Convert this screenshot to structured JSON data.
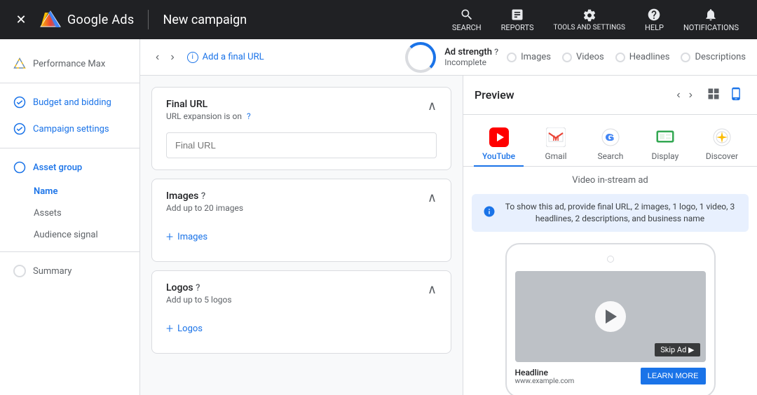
{
  "topNav": {
    "close_label": "×",
    "logo_text": "Google Ads",
    "campaign_title": "New campaign",
    "actions": [
      {
        "id": "search",
        "label": "SEARCH",
        "icon": "search"
      },
      {
        "id": "reports",
        "label": "REPORTS",
        "icon": "bar-chart"
      },
      {
        "id": "tools",
        "label": "TOOLS AND\nSETTINGS",
        "icon": "wrench"
      },
      {
        "id": "help",
        "label": "HELP",
        "icon": "question"
      },
      {
        "id": "notifications",
        "label": "NOTIFICATIONS",
        "icon": "bell"
      }
    ]
  },
  "sidebar": {
    "items": [
      {
        "id": "performance-max",
        "label": "Performance Max",
        "status": "active",
        "icon": "triangle"
      },
      {
        "id": "budget-bidding",
        "label": "Budget and bidding",
        "status": "complete"
      },
      {
        "id": "campaign-settings",
        "label": "Campaign settings",
        "status": "complete"
      },
      {
        "id": "asset-group",
        "label": "Asset group",
        "status": "current",
        "subitems": [
          {
            "id": "name",
            "label": "Name",
            "active": true
          },
          {
            "id": "assets",
            "label": "Assets",
            "active": false
          },
          {
            "id": "audience-signal",
            "label": "Audience signal",
            "active": false
          }
        ]
      },
      {
        "id": "summary",
        "label": "Summary",
        "status": "none"
      }
    ]
  },
  "subHeader": {
    "add_url_label": "Add a final URL",
    "ad_strength_label": "Ad strength",
    "ad_strength_value": "Incomplete",
    "asset_buttons": [
      {
        "id": "images",
        "label": "Images"
      },
      {
        "id": "videos",
        "label": "Videos"
      },
      {
        "id": "headlines",
        "label": "Headlines"
      },
      {
        "id": "descriptions",
        "label": "Descriptions"
      }
    ]
  },
  "editor": {
    "sections": [
      {
        "id": "final-url",
        "title": "Final URL",
        "subtitle": "URL expansion is on",
        "input_placeholder": "Final URL",
        "collapsed": false
      },
      {
        "id": "images",
        "title": "Images",
        "subtitle": "Add up to 20 images",
        "add_label": "Images",
        "collapsed": false
      },
      {
        "id": "logos",
        "title": "Logos",
        "subtitle": "Add up to 5 logos",
        "add_label": "Logos",
        "collapsed": false
      }
    ]
  },
  "preview": {
    "title": "Preview",
    "platforms": [
      {
        "id": "youtube",
        "label": "YouTube",
        "active": true
      },
      {
        "id": "gmail",
        "label": "Gmail",
        "active": false
      },
      {
        "id": "search",
        "label": "Search",
        "active": false
      },
      {
        "id": "display",
        "label": "Display",
        "active": false
      },
      {
        "id": "discover",
        "label": "Discover",
        "active": false
      }
    ],
    "ad_type": "Video in-stream ad",
    "info_text": "To show this ad, provide final URL, 2 images, 1 logo, 1 video, 3 headlines, 2 descriptions, and business name",
    "phone": {
      "headline": "Headline",
      "url": "www.example.com",
      "skip_ad": "Skip Ad ▶",
      "learn_more": "LEARN MORE"
    }
  }
}
